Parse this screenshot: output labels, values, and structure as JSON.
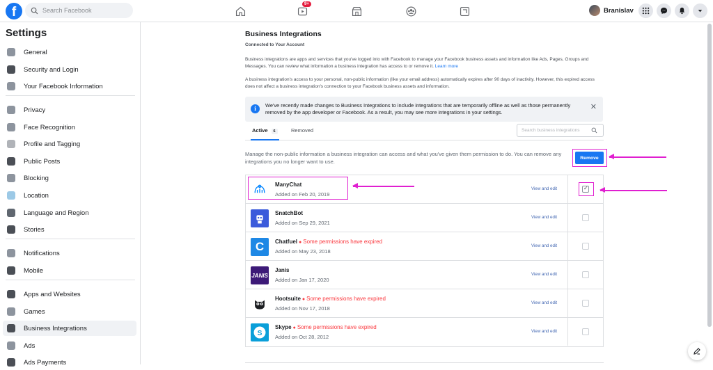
{
  "topbar": {
    "logo_letter": "f",
    "search_placeholder": "Search Facebook",
    "watch_badge": "9+",
    "profile_name": "Branislav"
  },
  "sidebar": {
    "title": "Settings",
    "items": [
      {
        "label": "General",
        "icon": "gear-icon",
        "color": "#8d949e"
      },
      {
        "label": "Security and Login",
        "icon": "shield-icon",
        "color": "#4b4f56"
      },
      {
        "label": "Your Facebook Information",
        "icon": "grid-icon",
        "color": "#8d949e"
      },
      {
        "label": "Privacy",
        "icon": "lock-icon",
        "color": "#8d949e"
      },
      {
        "label": "Face Recognition",
        "icon": "face-icon",
        "color": "#8d949e"
      },
      {
        "label": "Profile and Tagging",
        "icon": "tag-icon",
        "color": "#b0b3b8"
      },
      {
        "label": "Public Posts",
        "icon": "globe-icon",
        "color": "#4b4f56"
      },
      {
        "label": "Blocking",
        "icon": "block-icon",
        "color": "#8d949e"
      },
      {
        "label": "Location",
        "icon": "location-icon",
        "color": "#9cc9e6"
      },
      {
        "label": "Language and Region",
        "icon": "language-icon",
        "color": "#606770"
      },
      {
        "label": "Stories",
        "icon": "book-icon",
        "color": "#4b4f56"
      },
      {
        "label": "Notifications",
        "icon": "bell-icon",
        "color": "#8d949e"
      },
      {
        "label": "Mobile",
        "icon": "phone-icon",
        "color": "#4b4f56"
      },
      {
        "label": "Apps and Websites",
        "icon": "cube-icon",
        "color": "#4b4f56"
      },
      {
        "label": "Games",
        "icon": "gamepad-icon",
        "color": "#8d949e"
      },
      {
        "label": "Business Integrations",
        "icon": "briefcase-icon",
        "color": "#4b4f56"
      },
      {
        "label": "Ads",
        "icon": "ads-icon",
        "color": "#8d949e"
      },
      {
        "label": "Ads Payments",
        "icon": "card-icon",
        "color": "#4b4f56"
      }
    ],
    "active_item": "Business Integrations"
  },
  "main": {
    "title": "Business Integrations",
    "subtitle": "Connected to Your Account",
    "para1": "Business integrations are apps and services that you've logged into with Facebook to manage your Facebook business assets and information like Ads, Pages, Groups and Messages. You can review what information a business integration has access to or remove it.",
    "para1_link": "Learn more",
    "para2": "A business integration's access to your personal, non-public information (like your email address) automatically expires after 90 days of inactivity. However, this expired access does not affect a business integration's connection to your Facebook business assets and information.",
    "notice": "We've recently made changes to Business Integrations to include integrations that are temporarily offline as well as those permanently removed by the app developer or Facebook. As a result, you may see more integrations in your settings.",
    "tabs": {
      "active_label": "Active",
      "active_count": "6",
      "removed_label": "Removed",
      "search_placeholder": "Search business integrations"
    },
    "manage_text": "Manage the non-public information a business integration can access and what you've given them permission to do. You can remove any integrations you no longer want to use.",
    "remove_label": "Remove",
    "view_edit_label": "View and edit",
    "integrations": [
      {
        "name": "ManyChat",
        "added": "Added on Feb 20, 2019",
        "warning": "",
        "checked": true,
        "logo_bg": "#ffffff",
        "logo_color": "#0084ff"
      },
      {
        "name": "SnatchBot",
        "added": "Added on Sep 29, 2021",
        "warning": "",
        "checked": false,
        "logo_bg": "#3b5bdb",
        "logo_color": "#ffffff"
      },
      {
        "name": "Chatfuel",
        "added": "Added on May 23, 2018",
        "warning": "Some permissions have expired",
        "checked": false,
        "logo_bg": "#1e88e5",
        "logo_color": "#ffffff"
      },
      {
        "name": "Janis",
        "added": "Added on Jan 17, 2020",
        "warning": "",
        "checked": false,
        "logo_bg": "#3d1a78",
        "logo_color": "#ffffff"
      },
      {
        "name": "Hootsuite",
        "added": "Added on Nov 17, 2018",
        "warning": "Some permissions have expired",
        "checked": false,
        "logo_bg": "#ffffff",
        "logo_color": "#1c1e21"
      },
      {
        "name": "Skype",
        "added": "Added on Oct 28, 2012",
        "warning": "Some permissions have expired",
        "checked": false,
        "logo_bg": "#0a9fd9",
        "logo_color": "#ffffff"
      }
    ]
  },
  "colors": {
    "accent": "#1877f2",
    "annotation": "#e01fd0",
    "warning": "#fa383e"
  }
}
